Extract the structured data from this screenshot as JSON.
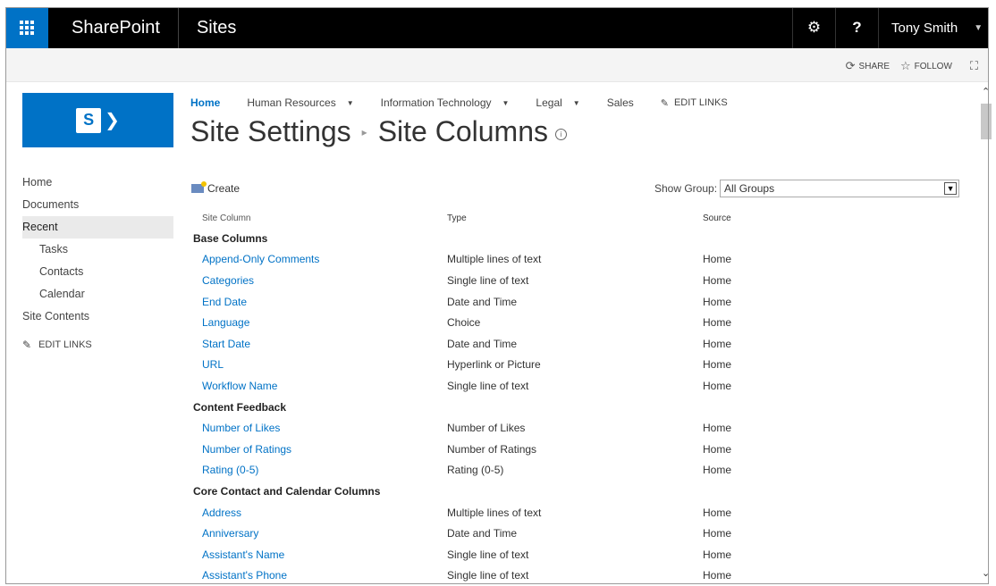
{
  "suite": {
    "brand": "SharePoint",
    "sites": "Sites",
    "settings_icon": "gear-icon",
    "help_label": "?",
    "user_name": "Tony Smith"
  },
  "ribbon": {
    "share": "SHARE",
    "follow": "FOLLOW"
  },
  "leftnav": {
    "items": [
      {
        "label": "Home"
      },
      {
        "label": "Documents"
      },
      {
        "label": "Recent"
      },
      {
        "label": "Tasks"
      },
      {
        "label": "Contacts"
      },
      {
        "label": "Calendar"
      },
      {
        "label": "Site Contents"
      }
    ],
    "edit_links": "EDIT LINKS"
  },
  "topnav": {
    "home": "Home",
    "hr": "Human Resources",
    "it": "Information Technology",
    "legal": "Legal",
    "sales": "Sales",
    "edit_links": "EDIT LINKS"
  },
  "title": {
    "part1": "Site Settings",
    "part2": "Site Columns"
  },
  "toolbar": {
    "create": "Create",
    "show_group_label": "Show Group:",
    "show_group_value": "All Groups"
  },
  "table": {
    "headers": {
      "col": "Site Column",
      "type": "Type",
      "source": "Source"
    },
    "groups": [
      {
        "name": "Base Columns",
        "rows": [
          {
            "col": "Append-Only Comments",
            "type": "Multiple lines of text",
            "source": "Home"
          },
          {
            "col": "Categories",
            "type": "Single line of text",
            "source": "Home"
          },
          {
            "col": "End Date",
            "type": "Date and Time",
            "source": "Home"
          },
          {
            "col": "Language",
            "type": "Choice",
            "source": "Home"
          },
          {
            "col": "Start Date",
            "type": "Date and Time",
            "source": "Home"
          },
          {
            "col": "URL",
            "type": "Hyperlink or Picture",
            "source": "Home"
          },
          {
            "col": "Workflow Name",
            "type": "Single line of text",
            "source": "Home"
          }
        ]
      },
      {
        "name": "Content Feedback",
        "rows": [
          {
            "col": "Number of Likes",
            "type": "Number of Likes",
            "source": "Home"
          },
          {
            "col": "Number of Ratings",
            "type": "Number of Ratings",
            "source": "Home"
          },
          {
            "col": "Rating (0-5)",
            "type": "Rating (0-5)",
            "source": "Home"
          }
        ]
      },
      {
        "name": "Core Contact and Calendar Columns",
        "rows": [
          {
            "col": "Address",
            "type": "Multiple lines of text",
            "source": "Home"
          },
          {
            "col": "Anniversary",
            "type": "Date and Time",
            "source": "Home"
          },
          {
            "col": "Assistant's Name",
            "type": "Single line of text",
            "source": "Home"
          },
          {
            "col": "Assistant's Phone",
            "type": "Single line of text",
            "source": "Home"
          }
        ]
      }
    ]
  },
  "colors": {
    "brand_blue": "#0072c6",
    "suitebar": "#000000",
    "link": "#0072c6"
  }
}
